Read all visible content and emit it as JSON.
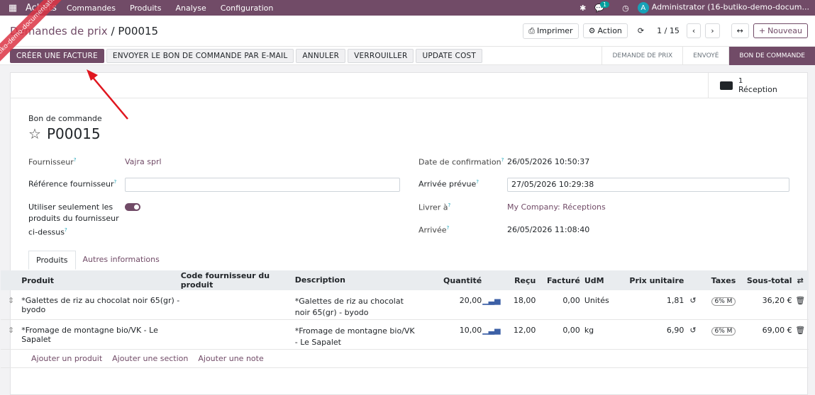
{
  "navbar": {
    "app_name": "Achats",
    "menu": [
      "Commandes",
      "Produits",
      "Analyse",
      "Configuration"
    ],
    "chat_badge": "1",
    "avatar_letter": "A",
    "user": "Administrator (16-butiko-demo-docum..."
  },
  "control_panel": {
    "breadcrumb_parent": "Demandes de prix",
    "breadcrumb_sep": "/",
    "breadcrumb_current": "P00015",
    "print_label": "Imprimer",
    "action_label": "Action",
    "pager": "1 / 15",
    "new_label": "Nouveau"
  },
  "statusbar": {
    "buttons": [
      "CRÉER UNE FACTURE",
      "ENVOYER LE BON DE COMMANDE PAR E-MAIL",
      "ANNULER",
      "VERROUILLER",
      "UPDATE COST"
    ],
    "stages": [
      "DEMANDE DE PRIX",
      "ENVOYÉ",
      "BON DE COMMANDE"
    ],
    "active_stage": "BON DE COMMANDE"
  },
  "smart_button": {
    "value": "1",
    "label": "Réception"
  },
  "form": {
    "title_label": "Bon de commande",
    "title": "P00015",
    "fournisseur_label": "Fournisseur",
    "fournisseur_value": "Vajra sprl",
    "ref_label": "Référence fournisseur",
    "ref_value": "",
    "only_vendor_label": "Utiliser seulement les produits du fournisseur ci-dessus",
    "confirm_label": "Date de confirmation",
    "confirm_value": "26/05/2026 10:50:37",
    "expected_label": "Arrivée prévue",
    "expected_value": "27/05/2026 10:29:38",
    "deliver_label": "Livrer à",
    "deliver_value": "My Company: Réceptions",
    "arrival_label": "Arrivée",
    "arrival_value": "26/05/2026 11:08:40",
    "help_mark": "?"
  },
  "tabs": [
    "Produits",
    "Autres informations"
  ],
  "table": {
    "headers": {
      "produit": "Produit",
      "code": "Code fournisseur du produit",
      "description": "Description",
      "quantite": "Quantité",
      "recu": "Reçu",
      "facture": "Facturé",
      "udm": "UdM",
      "prix": "Prix unitaire",
      "taxes": "Taxes",
      "sous_total": "Sous-total"
    },
    "rows": [
      {
        "produit": "*Galettes de riz au chocolat noir 65(gr) - byodo",
        "code": "",
        "description": "*Galettes de riz au chocolat noir 65(gr) - byodo",
        "quantite": "20,00",
        "recu": "18,00",
        "facture": "0,00",
        "udm": "Unités",
        "prix": "1,81",
        "taxes": "6% M",
        "sous_total": "36,20 €"
      },
      {
        "produit": "*Fromage de montagne bio/VK - Le Sapalet",
        "code": "",
        "description": "*Fromage de montagne bio/VK - Le Sapalet",
        "quantite": "10,00",
        "recu": "12,00",
        "facture": "0,00",
        "udm": "kg",
        "prix": "6,90",
        "taxes": "6% M",
        "sous_total": "69,00 €"
      }
    ],
    "add_links": [
      "Ajouter un produit",
      "Ajouter une section",
      "Ajouter une note"
    ]
  },
  "ribbon_text": "butiko-demo-documentation TEST",
  "colors": {
    "brand": "#714b67",
    "link": "#714b67",
    "accent": "#00a09d",
    "ribbon": "#dc3545",
    "arrow": "#e0161f"
  }
}
